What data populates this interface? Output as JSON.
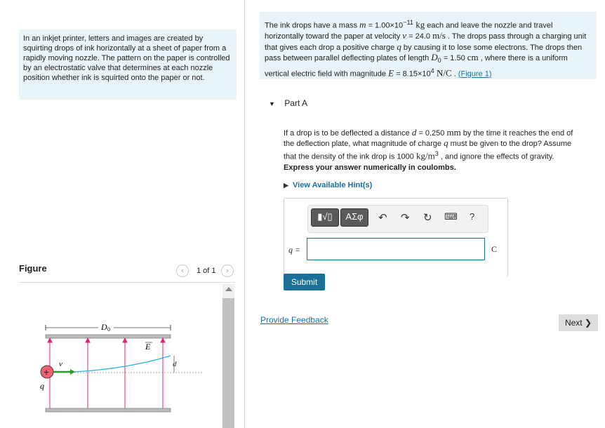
{
  "intro": "In an inkjet printer, letters and images are created by squirting drops of ink horizontally at a sheet of paper from a rapidly moving nozzle. The pattern on the paper is controlled by an electrostatic valve that determines at each nozzle position whether ink is squirted onto the paper or not.",
  "problem": {
    "t1": "The ink drops have a mass ",
    "m": "m",
    "t2": " = 1.00×10",
    "e1": "−11",
    "u1": " kg",
    "t3": " each and leave the nozzle and travel horizontally toward the paper at velocity ",
    "v": "v",
    "t4": " = 24.0 ",
    "u2": "m/s",
    "t5": " . The drops pass through a charging unit that gives each drop a positive charge ",
    "q": "q",
    "t6": " by causing it to lose some electrons. The drops then pass between parallel deflecting plates of length ",
    "D": "D",
    "d0": "0",
    "t7": " = 1.50 ",
    "u3": "cm",
    "t8": " , where there is a uniform vertical electric field with magnitude ",
    "E": "E",
    "t9": " = 8.15×10",
    "e2": "4",
    "u4": " N/C",
    "t10": " . ",
    "link": "(Figure 1)"
  },
  "part": {
    "label": "Part A",
    "q1": "If a drop is to be deflected a distance ",
    "d": "d",
    "q2": " = 0.250 ",
    "u1": "mm",
    "q3": " by the time it reaches the end of the deflection plate, what magnitude of charge ",
    "q": "q",
    "q4": " must be given to the drop? Assume that the density of the ink drop is 1000 ",
    "u2": "kg/m",
    "e": "3",
    "q5": " , and ignore the effects of gravity.",
    "express": "Express your answer numerically in coulombs.",
    "hint": "View Available Hint(s)",
    "tools": {
      "template": "▮√▯",
      "greek": "ΑΣφ",
      "undo": "↶",
      "redo": "↷",
      "reset": "↻",
      "keyboard": "⌨",
      "help": "?"
    },
    "var_label": "q =",
    "input_value": "",
    "unit": "C",
    "submit": "Submit"
  },
  "feedback": "Provide Feedback",
  "next": "Next ❯",
  "figure": {
    "title": "Figure",
    "pager": "1 of 1",
    "labels": {
      "D": "D",
      "sub": "0",
      "E": "E",
      "v": "v",
      "d": "d",
      "q": "q",
      "plus": "+"
    }
  },
  "colors": {
    "accent": "#1a7096",
    "panel": "#e8f4f7",
    "field": "#e8207a",
    "trajectory": "#2ab0e0",
    "velocity": "#2a9a2a",
    "charge": "#f06070"
  }
}
